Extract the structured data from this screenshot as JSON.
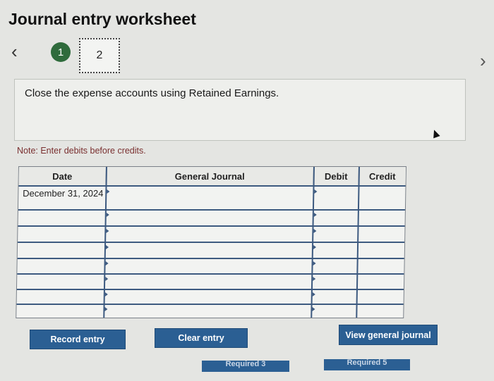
{
  "title": "Journal entry worksheet",
  "steps": {
    "prev_icon": "chevron-left-icon",
    "next_icon": "chevron-right-icon",
    "step1_label": "1",
    "step2_label": "2",
    "completed_color": "#2f6b3c"
  },
  "instruction": "Close the expense accounts using Retained Earnings.",
  "note": "Note: Enter debits before credits.",
  "table": {
    "headers": [
      "Date",
      "General Journal",
      "Debit",
      "Credit"
    ],
    "first_date": "December 31, 2024"
  },
  "buttons": {
    "record": "Record entry",
    "clear": "Clear entry",
    "view": "View general journal",
    "required_prev": "Required 3",
    "required_next": "Required 5"
  },
  "colors": {
    "button_blue": "#2b5f93",
    "note_red": "#7a3030"
  }
}
